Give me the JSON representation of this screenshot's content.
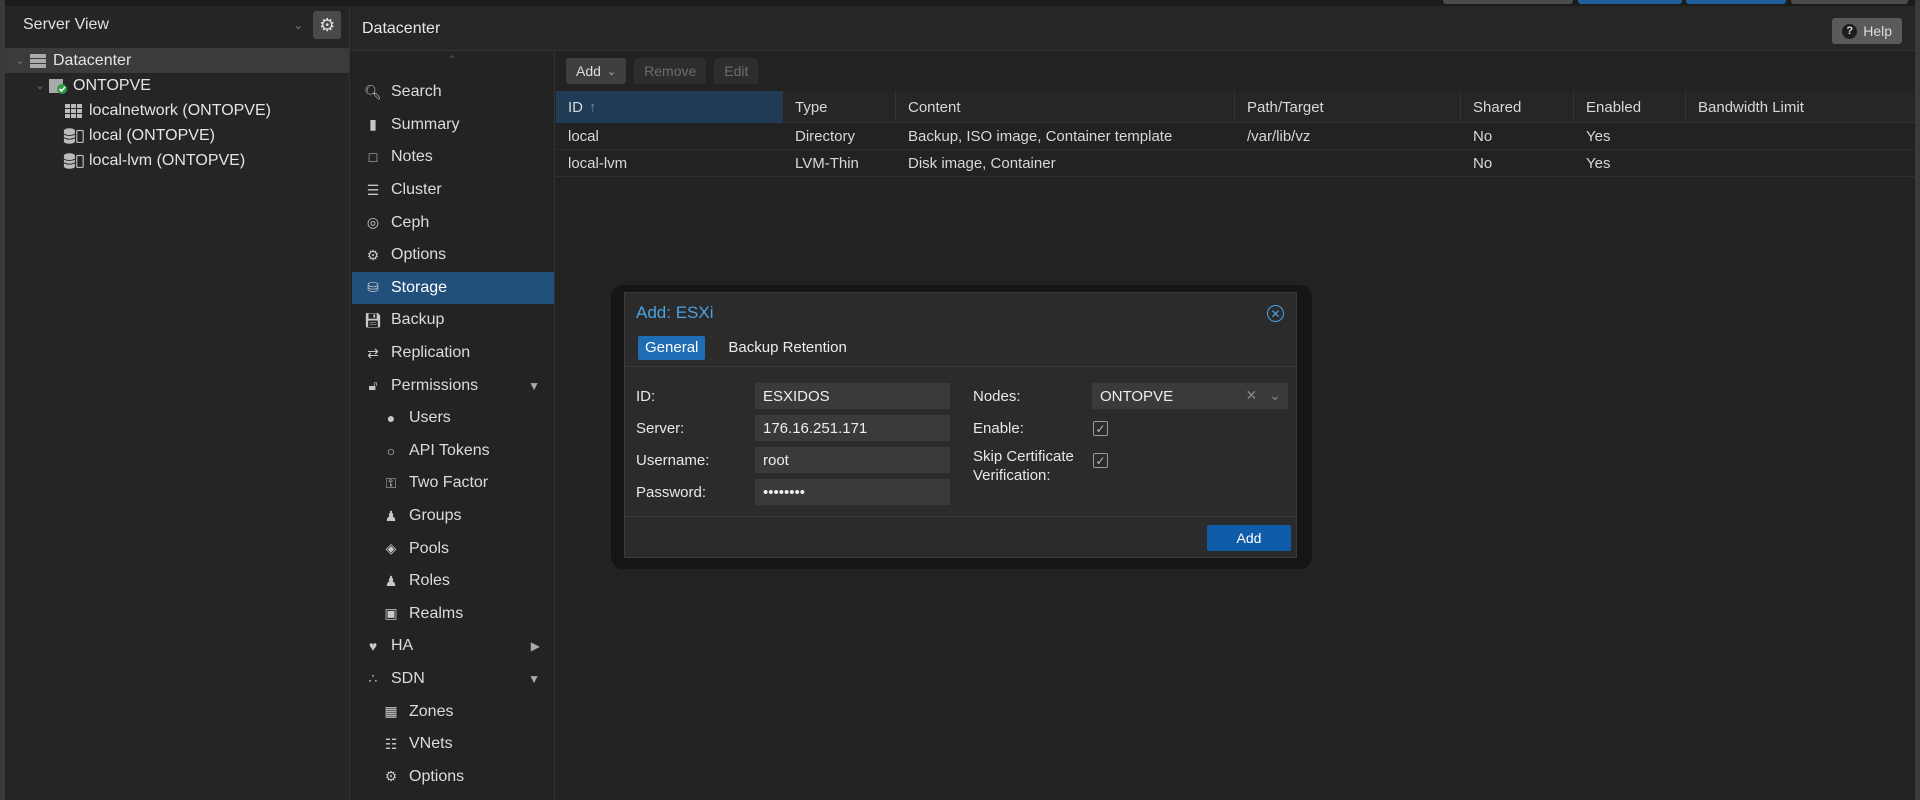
{
  "tree": {
    "view_label": "Server View",
    "nodes": [
      {
        "label": "Datacenter",
        "icon": "server-rack-icon"
      },
      {
        "label": "ONTOPVE",
        "icon": "node-online-icon"
      },
      {
        "label": "localnetwork (ONTOPVE)",
        "icon": "sdn-grid-icon"
      },
      {
        "label": "local (ONTOPVE)",
        "icon": "storage-icon"
      },
      {
        "label": "local-lvm (ONTOPVE)",
        "icon": "storage-icon"
      }
    ]
  },
  "header": {
    "title": "Datacenter",
    "help_label": "Help"
  },
  "nav": {
    "items": [
      {
        "label": "Search",
        "icon": "search-icon"
      },
      {
        "label": "Summary",
        "icon": "book-icon"
      },
      {
        "label": "Notes",
        "icon": "notes-icon"
      },
      {
        "label": "Cluster",
        "icon": "cluster-icon"
      },
      {
        "label": "Ceph",
        "icon": "ceph-icon"
      },
      {
        "label": "Options",
        "icon": "gear-icon"
      },
      {
        "label": "Storage",
        "icon": "database-icon"
      },
      {
        "label": "Backup",
        "icon": "floppy-icon"
      },
      {
        "label": "Replication",
        "icon": "replication-icon"
      },
      {
        "label": "Permissions",
        "icon": "unlock-icon"
      },
      {
        "label": "Users",
        "icon": "user-icon"
      },
      {
        "label": "API Tokens",
        "icon": "user-outline-icon"
      },
      {
        "label": "Two Factor",
        "icon": "key-icon"
      },
      {
        "label": "Groups",
        "icon": "users-icon"
      },
      {
        "label": "Pools",
        "icon": "tags-icon"
      },
      {
        "label": "Roles",
        "icon": "male-icon"
      },
      {
        "label": "Realms",
        "icon": "address-book-icon"
      },
      {
        "label": "HA",
        "icon": "heartbeat-icon"
      },
      {
        "label": "SDN",
        "icon": "sdn-icon"
      },
      {
        "label": "Zones",
        "icon": "grid-icon"
      },
      {
        "label": "VNets",
        "icon": "sitemap-icon"
      },
      {
        "label": "Options",
        "icon": "gear-icon"
      }
    ]
  },
  "toolbar": {
    "add_label": "Add",
    "remove_label": "Remove",
    "edit_label": "Edit"
  },
  "grid": {
    "columns": [
      "ID",
      "Type",
      "Content",
      "Path/Target",
      "Shared",
      "Enabled",
      "Bandwidth Limit"
    ],
    "rows": [
      [
        "local",
        "Directory",
        "Backup, ISO image, Container template",
        "/var/lib/vz",
        "No",
        "Yes",
        ""
      ],
      [
        "local-lvm",
        "LVM-Thin",
        "Disk image, Container",
        "",
        "No",
        "Yes",
        ""
      ]
    ]
  },
  "dialog": {
    "title": "Add: ESXi",
    "tabs": [
      "General",
      "Backup Retention"
    ],
    "id_label": "ID:",
    "id_value": "ESXIDOS",
    "server_label": "Server:",
    "server_value": "176.16.251.171",
    "username_label": "Username:",
    "username_value": "root",
    "password_label": "Password:",
    "password_value": "••••••••",
    "nodes_label": "Nodes:",
    "nodes_value": "ONTOPVE",
    "enable_label": "Enable:",
    "enable_checked": true,
    "skip_cert_label_1": "Skip Certificate",
    "skip_cert_label_2": "Verification:",
    "skip_cert_checked": true,
    "add_button": "Add"
  },
  "colors": {
    "accent": "#1f6eb5",
    "active_nav": "#21507d",
    "title_blue": "#4aa3e6",
    "bg": "#222222"
  }
}
